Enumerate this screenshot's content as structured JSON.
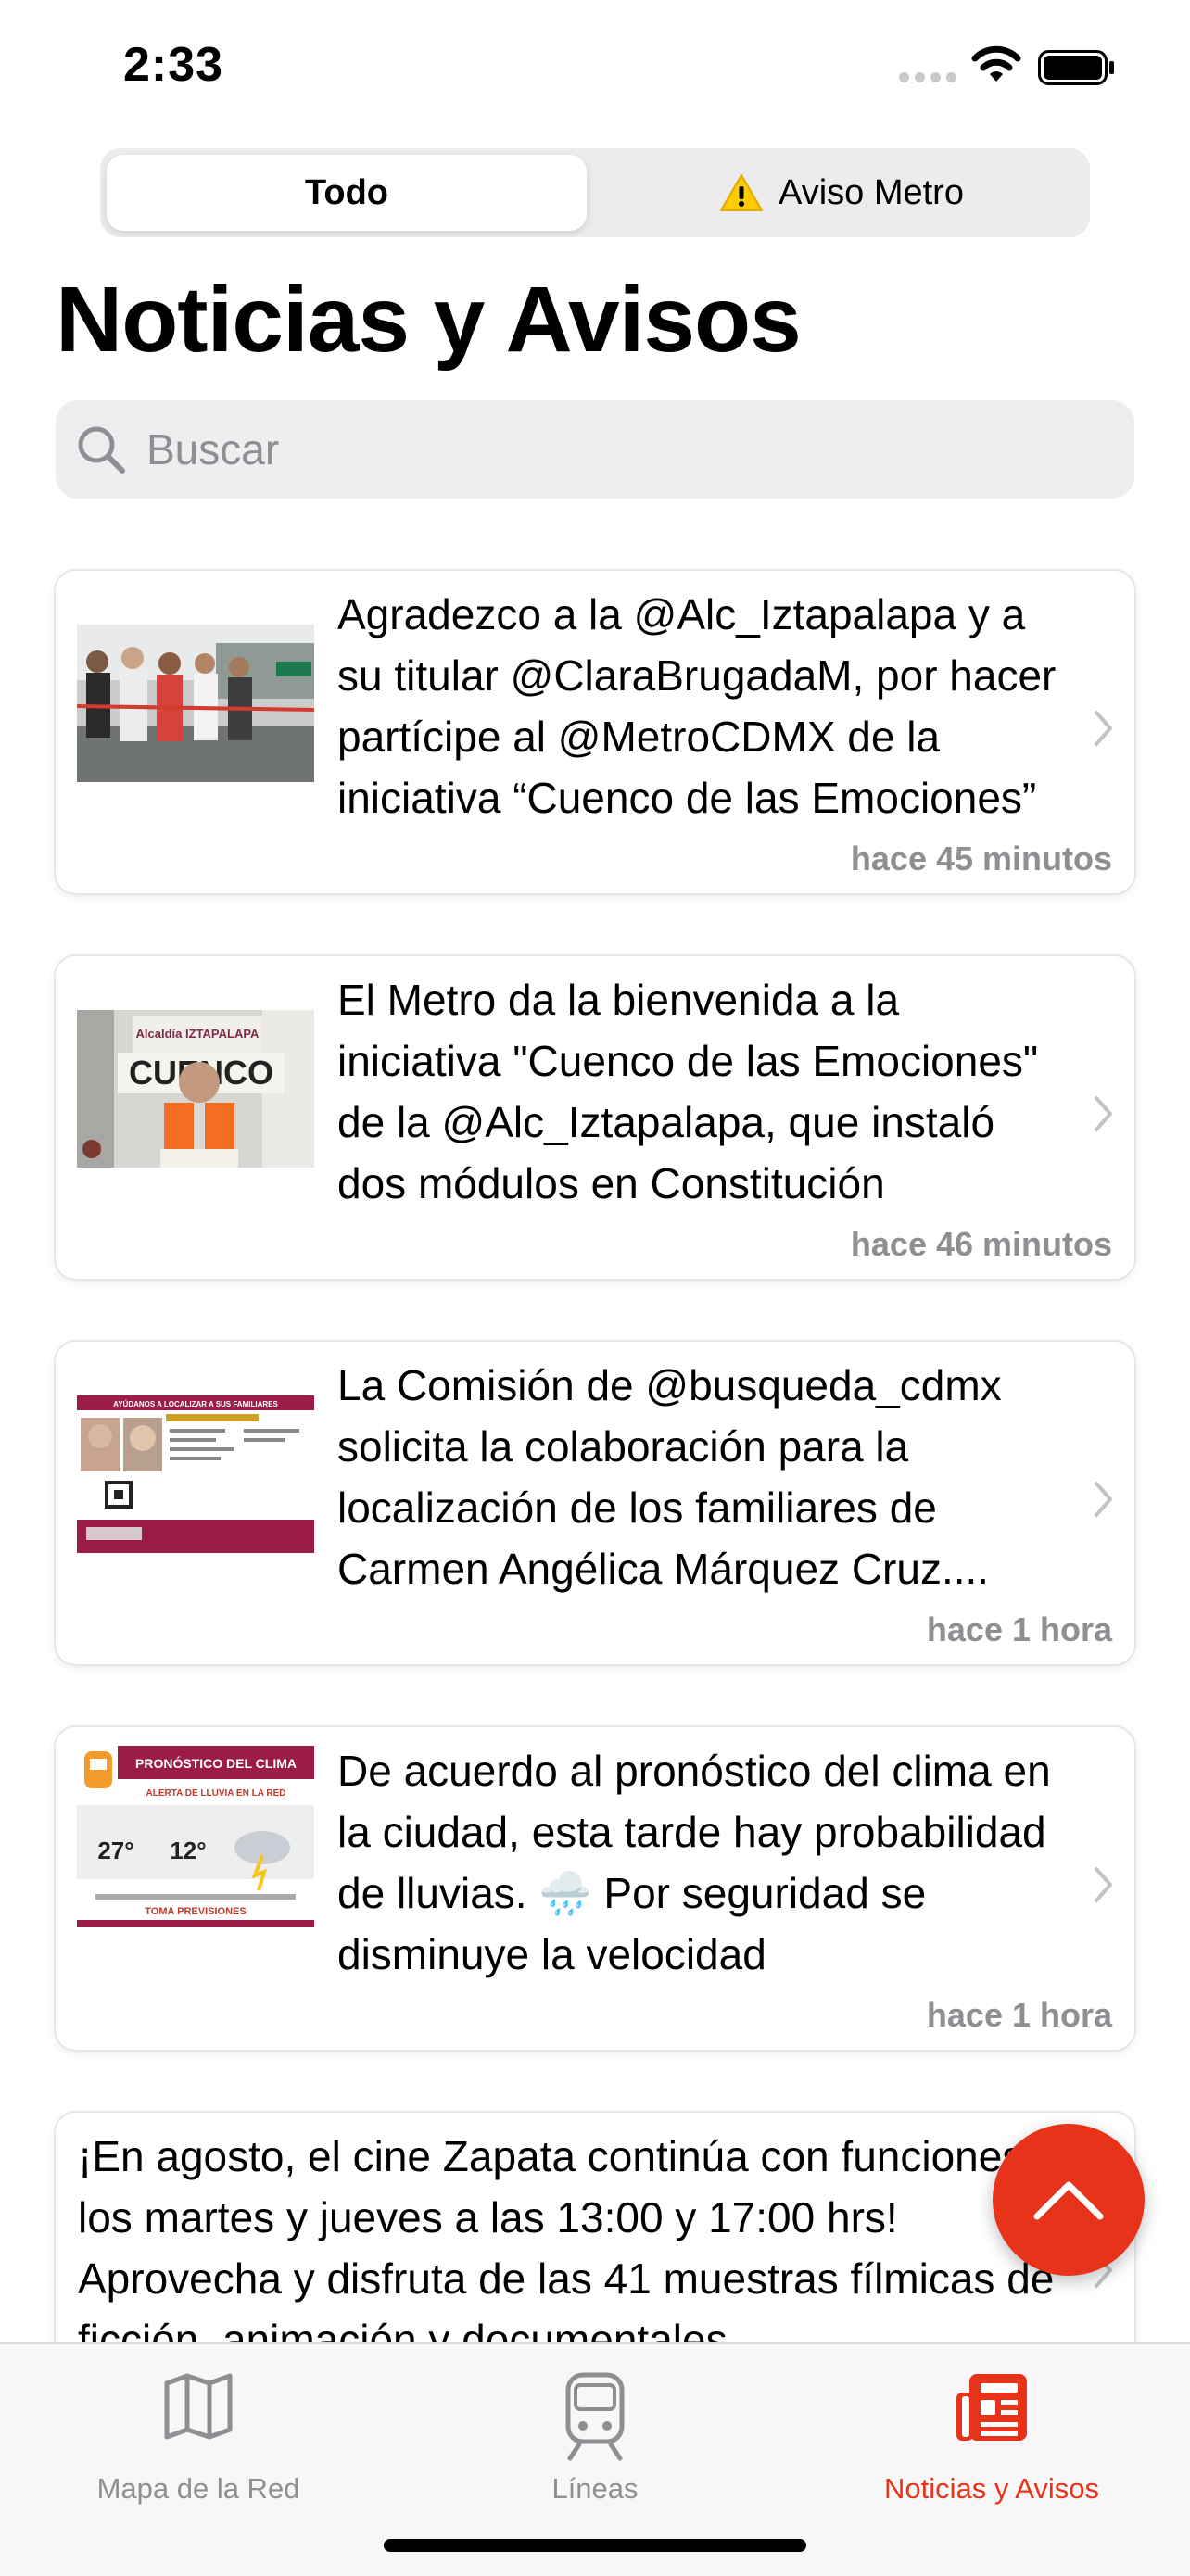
{
  "status": {
    "time": "2:33"
  },
  "segments": [
    {
      "label": "Todo"
    },
    {
      "label": "Aviso Metro"
    }
  ],
  "page_title": "Noticias y Avisos",
  "search": {
    "placeholder": "Buscar"
  },
  "news": [
    {
      "text": "Agradezco a la @Alc_Iztapalapa y a su titular @ClaraBrugadaM, por hacer partícipe al @MetroCDMX de la iniciativa “Cuenco de las Emociones”",
      "time": "hace 45 minutos"
    },
    {
      "text": "El Metro da la bienvenida a la iniciativa \"Cuenco de las Emociones\" de la @Alc_Iztapalapa, que instaló dos módulos en Constitución",
      "time": "hace 46 minutos"
    },
    {
      "text": "La Comisión de @busqueda_cdmx solicita la colaboración para la localización de los familiares de Carmen Angélica Márquez Cruz....",
      "time": "hace 1 hora"
    },
    {
      "text": "De acuerdo al pronóstico del clima en la ciudad, esta tarde hay probabilidad de lluvias. 🌧️ Por seguridad se disminuye la velocidad",
      "time": "hace 1 hora"
    },
    {
      "text": "¡En agosto, el cine Zapata continúa con funciones los martes y jueves a las 13:00 y 17:00 hrs! Aprovecha y disfruta de las 41 muestras fílmicas de ficción, animación y documentales",
      "time": ""
    }
  ],
  "thumbs": {
    "cuenco_sign": "Alcaldía IZTAPALAPA",
    "cuenco_word": "CUENCO",
    "weather_title": "PRONÓSTICO DEL CLIMA",
    "weather_alert": "ALERTA DE LLUVIA EN LA RED",
    "weather_high": "27°",
    "weather_low": "12°",
    "weather_cta": "TOMA PREVISIONES",
    "missing_header": "AYÚDANOS A LOCALIZAR A SUS FAMILIARES"
  },
  "tabs": [
    {
      "label": "Mapa de la Red",
      "icon": "map-icon"
    },
    {
      "label": "Líneas",
      "icon": "train-icon"
    },
    {
      "label": "Noticias y Avisos",
      "icon": "news-icon"
    }
  ],
  "colors": {
    "accent": "#e8331b",
    "gray": "#8e8e93"
  }
}
